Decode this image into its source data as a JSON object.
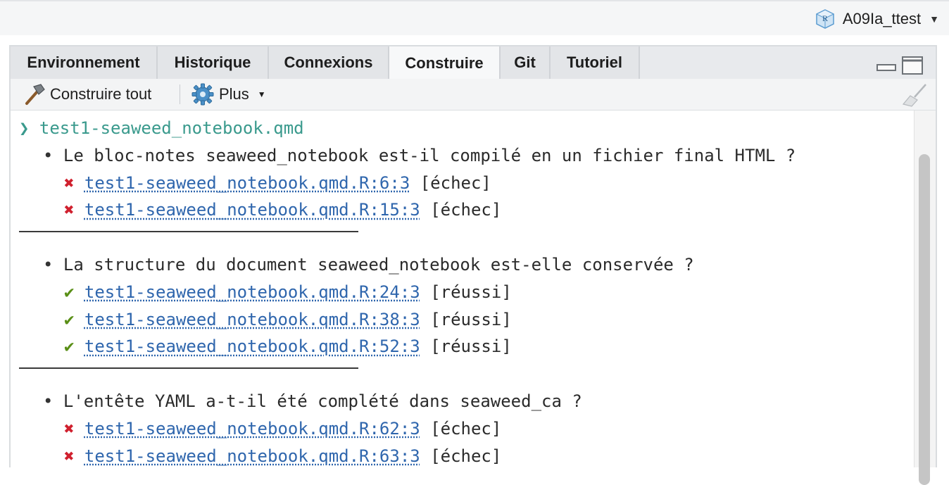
{
  "project": {
    "name": "A09Ia_ttest",
    "icon": "r-project-cube-icon"
  },
  "tabs": [
    {
      "label": "Environnement",
      "active": false
    },
    {
      "label": "Historique",
      "active": false
    },
    {
      "label": "Connexions",
      "active": false
    },
    {
      "label": "Construire",
      "active": true
    },
    {
      "label": "Git",
      "active": false
    },
    {
      "label": "Tutoriel",
      "active": false
    }
  ],
  "toolbar": {
    "build_all_label": "Construire tout",
    "build_all_icon": "hammer-icon",
    "more_label": "Plus",
    "more_icon": "gear-icon",
    "clear_icon": "broom-icon"
  },
  "console": {
    "header_glyph": "❯",
    "file": "test1-seaweed_notebook.qmd",
    "bullet_glyph": "•",
    "fail_glyph": "✖",
    "pass_glyph": "✔",
    "sections": [
      {
        "question": "Le bloc-notes seaweed_notebook est-il compilé en un fichier final HTML ?",
        "results": [
          {
            "status": "fail",
            "location": "test1-seaweed_notebook.qmd.R:6:3",
            "label": "[échec]"
          },
          {
            "status": "fail",
            "location": "test1-seaweed_notebook.qmd.R:15:3",
            "label": "[échec]"
          }
        ]
      },
      {
        "question": "La structure du document seaweed_notebook est-elle conservée ?",
        "results": [
          {
            "status": "pass",
            "location": "test1-seaweed_notebook.qmd.R:24:3",
            "label": "[réussi]"
          },
          {
            "status": "pass",
            "location": "test1-seaweed_notebook.qmd.R:38:3",
            "label": "[réussi]"
          },
          {
            "status": "pass",
            "location": "test1-seaweed_notebook.qmd.R:52:3",
            "label": "[réussi]"
          }
        ]
      },
      {
        "question": "L'entête YAML a-t-il été complété dans seaweed_ca ?",
        "results": [
          {
            "status": "fail",
            "location": "test1-seaweed_notebook.qmd.R:62:3",
            "label": "[échec]"
          },
          {
            "status": "fail",
            "location": "test1-seaweed_notebook.qmd.R:63:3",
            "label": "[échec]"
          }
        ]
      }
    ]
  },
  "colors": {
    "fail": "#d0202e",
    "pass": "#5a8f17",
    "link": "#2f66ad",
    "file_heading": "#3a9a8d"
  }
}
